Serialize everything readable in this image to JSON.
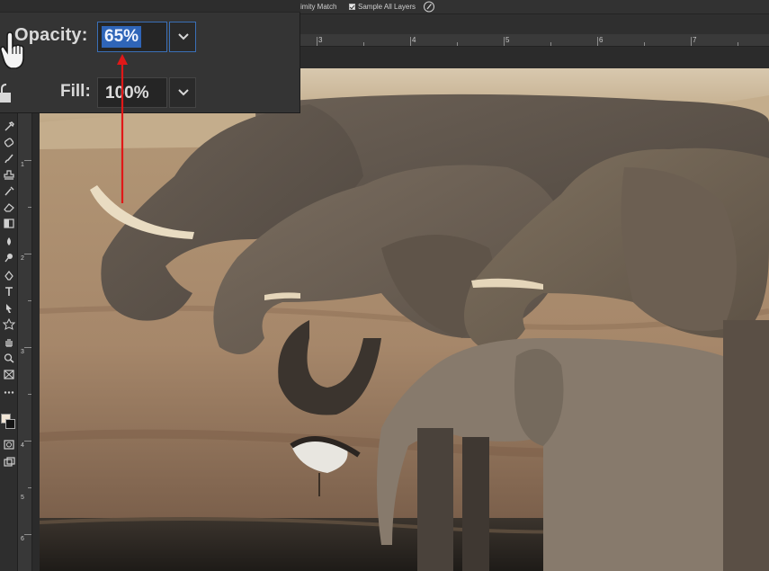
{
  "options_bar": {
    "similarity_label": "imity Match",
    "sample_all_layers_label": "Sample All Layers",
    "sample_all_layers_checked": true
  },
  "ruler": {
    "h_numbers": [
      "3",
      "4",
      "5",
      "6",
      "7"
    ],
    "v_numbers": [
      "1",
      "2",
      "3",
      "4",
      "5",
      "6"
    ]
  },
  "layers_panel": {
    "opacity_label": "Opacity:",
    "opacity_value": "65%",
    "fill_label": "Fill:",
    "fill_value": "100%"
  },
  "icons": {
    "hand": "hand-pointer-icon",
    "lock": "lock-icon",
    "dropdown": "chevron-down-icon",
    "brush": "brush-pressure-icon"
  },
  "colors": {
    "panel_bg": "#343434",
    "selection_blue": "#2f65b8",
    "annotation_red": "#e01818",
    "foreground_swatch": "#f2e6d6",
    "background_swatch": "#141414"
  }
}
